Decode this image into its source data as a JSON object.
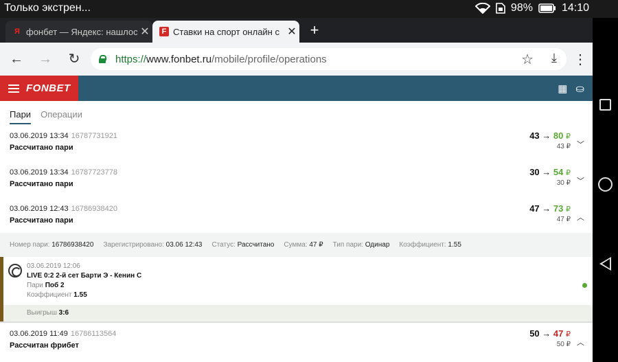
{
  "statusbar": {
    "notification": "Только экстрен...",
    "battery": "98%",
    "time": "14:10",
    "icons": [
      "wifi-icon",
      "sim-icon",
      "battery-icon"
    ]
  },
  "browser": {
    "tabs": [
      {
        "favicon": "Я",
        "favicon_color": "#e22",
        "title": "фонбет — Яндекс: нашлось"
      },
      {
        "favicon": "F",
        "favicon_color": "#d52a2a",
        "title": "Ставки на спорт онлайн с"
      }
    ],
    "url": {
      "scheme": "https://",
      "host": "www.fonbet.ru",
      "path": "/mobile/profile/operations"
    }
  },
  "site": {
    "brand": "FONBET",
    "brand_color": "#d52a2a",
    "header_color": "#2c5a73",
    "tabs": [
      "Пари",
      "Операции"
    ],
    "operations": [
      {
        "date": "03.06.2019 13:34",
        "id": "16787731921",
        "label": "Рассчитано пари",
        "stake": "43",
        "result": "80",
        "result_type": "win",
        "currency": "₽",
        "sub": "43 ₽",
        "chevron": "down"
      },
      {
        "date": "03.06.2019 13:34",
        "id": "16787723778",
        "label": "Рассчитано пари",
        "stake": "30",
        "result": "54",
        "result_type": "win",
        "currency": "₽",
        "sub": "30 ₽",
        "chevron": "down"
      },
      {
        "date": "03.06.2019 12:43",
        "id": "16786938420",
        "label": "Рассчитано пари",
        "stake": "47",
        "result": "73",
        "result_type": "win",
        "currency": "₽",
        "sub": "47 ₽",
        "chevron": "up"
      },
      {
        "date": "03.06.2019 11:49",
        "id": "16786113564",
        "label": "Рассчитан фрибет",
        "stake": "50",
        "result": "47",
        "result_type": "lose",
        "currency": "₽",
        "sub": "50 ₽",
        "chevron": "up"
      }
    ],
    "details": {
      "bet_no_label": "Номер пари:",
      "bet_no": "16786938420",
      "registered_label": "Зарегистрировано:",
      "registered": "03.06 12:43",
      "status_label": "Статус:",
      "status": "Рассчитано",
      "sum_label": "Сумма:",
      "sum": "47 ₽",
      "type_label": "Тип пари:",
      "type": "Одинар",
      "coef_label": "Коэффициент:",
      "coef": "1.55"
    },
    "event": {
      "date": "03.06.2019 12:06",
      "title": "LIVE 0:2 2-й сет Барти Э - Кенин С",
      "bet_label": "Пари",
      "bet": "Поб 2",
      "coef_label": "Коэффициент",
      "coef": "1.55",
      "result_label": "Выигрыш",
      "result": "3:6"
    }
  }
}
